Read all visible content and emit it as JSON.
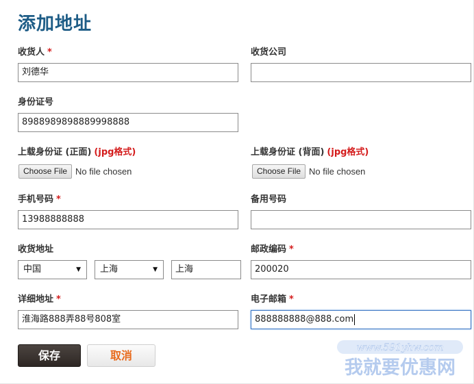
{
  "page": {
    "title": "添加地址"
  },
  "form": {
    "consignee": {
      "label": "收货人",
      "required_mark": "*",
      "value": "刘德华"
    },
    "company": {
      "label": "收货公司",
      "value": ""
    },
    "id_number": {
      "label": "身份证号",
      "value": "8988989898889998888"
    },
    "id_front": {
      "label": "上载身份证 (正面)",
      "format_note": "(jpg格式)",
      "button_label": "Choose File",
      "status": "No file chosen"
    },
    "id_back": {
      "label": "上载身份证 (背面)",
      "format_note": "(jpg格式)",
      "button_label": "Choose File",
      "status": "No file chosen"
    },
    "mobile": {
      "label": "手机号码",
      "required_mark": "*",
      "value": "13988888888"
    },
    "backup_phone": {
      "label": "备用号码",
      "value": ""
    },
    "region": {
      "label": "收货地址",
      "country": "中国",
      "province": "上海",
      "city": "上海",
      "arrow_icon": "triangle-down-icon"
    },
    "postcode": {
      "label": "邮政编码",
      "required_mark": "*",
      "value": "200020"
    },
    "street": {
      "label": "详细地址",
      "required_mark": "*",
      "value": "淮海路888弄88号808室"
    },
    "email": {
      "label": "电子邮箱",
      "required_mark": "*",
      "value": "888888888@888.com"
    }
  },
  "actions": {
    "save_label": "保存",
    "cancel_label": "取消"
  },
  "watermark": {
    "url": "www.591yhw.com",
    "name": "我就要优惠网"
  },
  "colors": {
    "title": "#1d5c86",
    "required": "#d41b1b",
    "save_bg": "#3a3330",
    "cancel_text": "#e86a1c",
    "watermark": "#8fb0e0",
    "focus_border": "#3a76c4"
  }
}
